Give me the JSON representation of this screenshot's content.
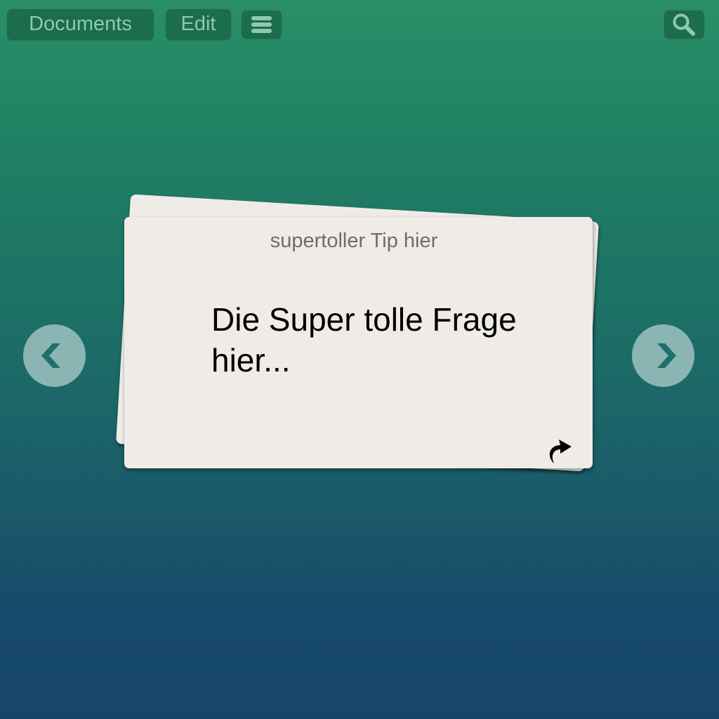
{
  "toolbar": {
    "documents_label": "Documents",
    "edit_label": "Edit",
    "menu_icon": "hamburger-menu-icon",
    "search_icon": "search-icon"
  },
  "navigation": {
    "prev_icon": "chevron-left-icon",
    "next_icon": "chevron-right-icon"
  },
  "card": {
    "tip": "supertoller Tip hier",
    "question": "Die Super tolle Frage hier...",
    "flip_icon": "curved-arrow-flip-icon"
  },
  "colors": {
    "background_top": "#2a8f68",
    "background_bottom": "#16456a",
    "card": "#efebe6",
    "button_text": "#8fc8b0",
    "nav_arrow_bg": "#8bb5b3",
    "nav_arrow_glyph": "#1f6f6f"
  }
}
